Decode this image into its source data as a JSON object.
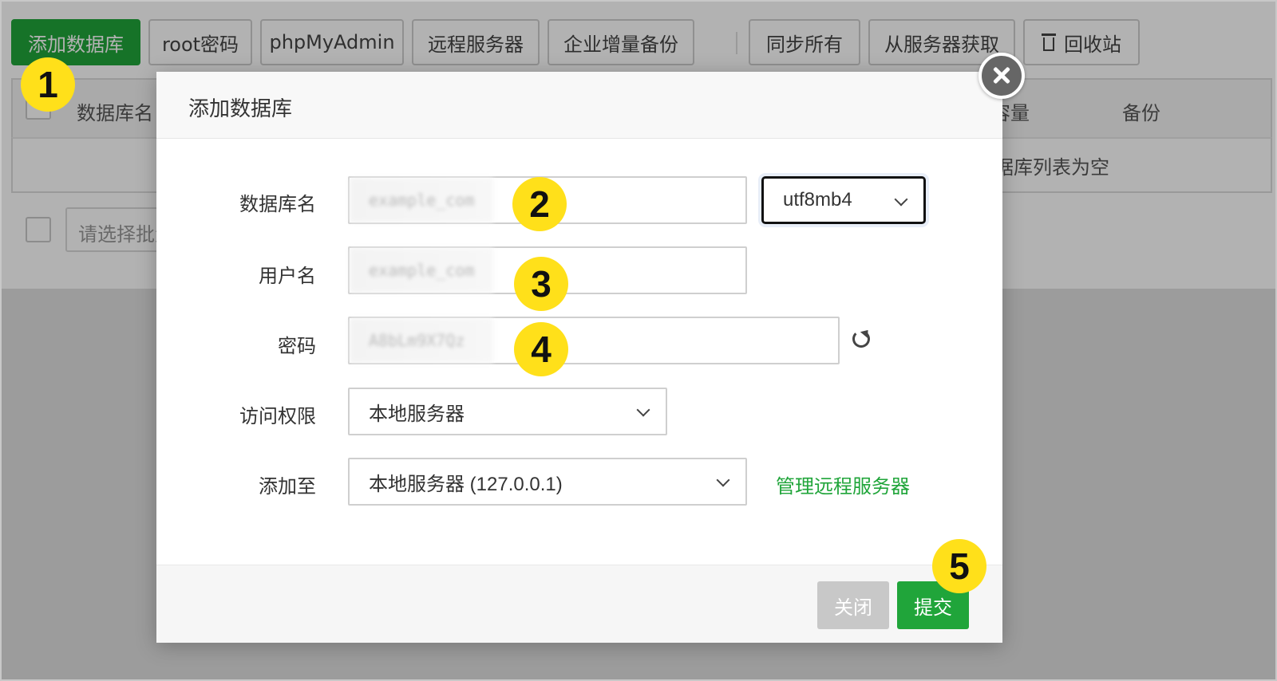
{
  "toolbar": {
    "add_db": "添加数据库",
    "root_pw": "root密码",
    "phpmyadmin": "phpMyAdmin",
    "remote": "远程服务器",
    "backup": "企业增量备份",
    "sync_all": "同步所有",
    "fetch": "从服务器获取",
    "recycle": "回收站"
  },
  "table": {
    "col_name": "数据库名",
    "col_capacity": "容量",
    "col_backup": "备份",
    "empty_text": "据库列表为空",
    "batch_placeholder": "请选择批量"
  },
  "modal": {
    "title": "添加数据库",
    "labels": {
      "db_name": "数据库名",
      "username": "用户名",
      "password": "密码",
      "access": "访问权限",
      "add_to": "添加至"
    },
    "blurred": {
      "db_name": "example_com",
      "username": "example_com",
      "password": "A8bLm9X7Qz"
    },
    "charset": "utf8mb4",
    "access_value": "本地服务器",
    "add_to_value": "本地服务器 (127.0.0.1)",
    "manage_link": "管理远程服务器",
    "close_button": "关闭",
    "submit_button": "提交"
  },
  "badges": [
    "1",
    "2",
    "3",
    "4",
    "5"
  ],
  "colors": {
    "accent": "#20a53a",
    "badge": "#ffe01a"
  }
}
